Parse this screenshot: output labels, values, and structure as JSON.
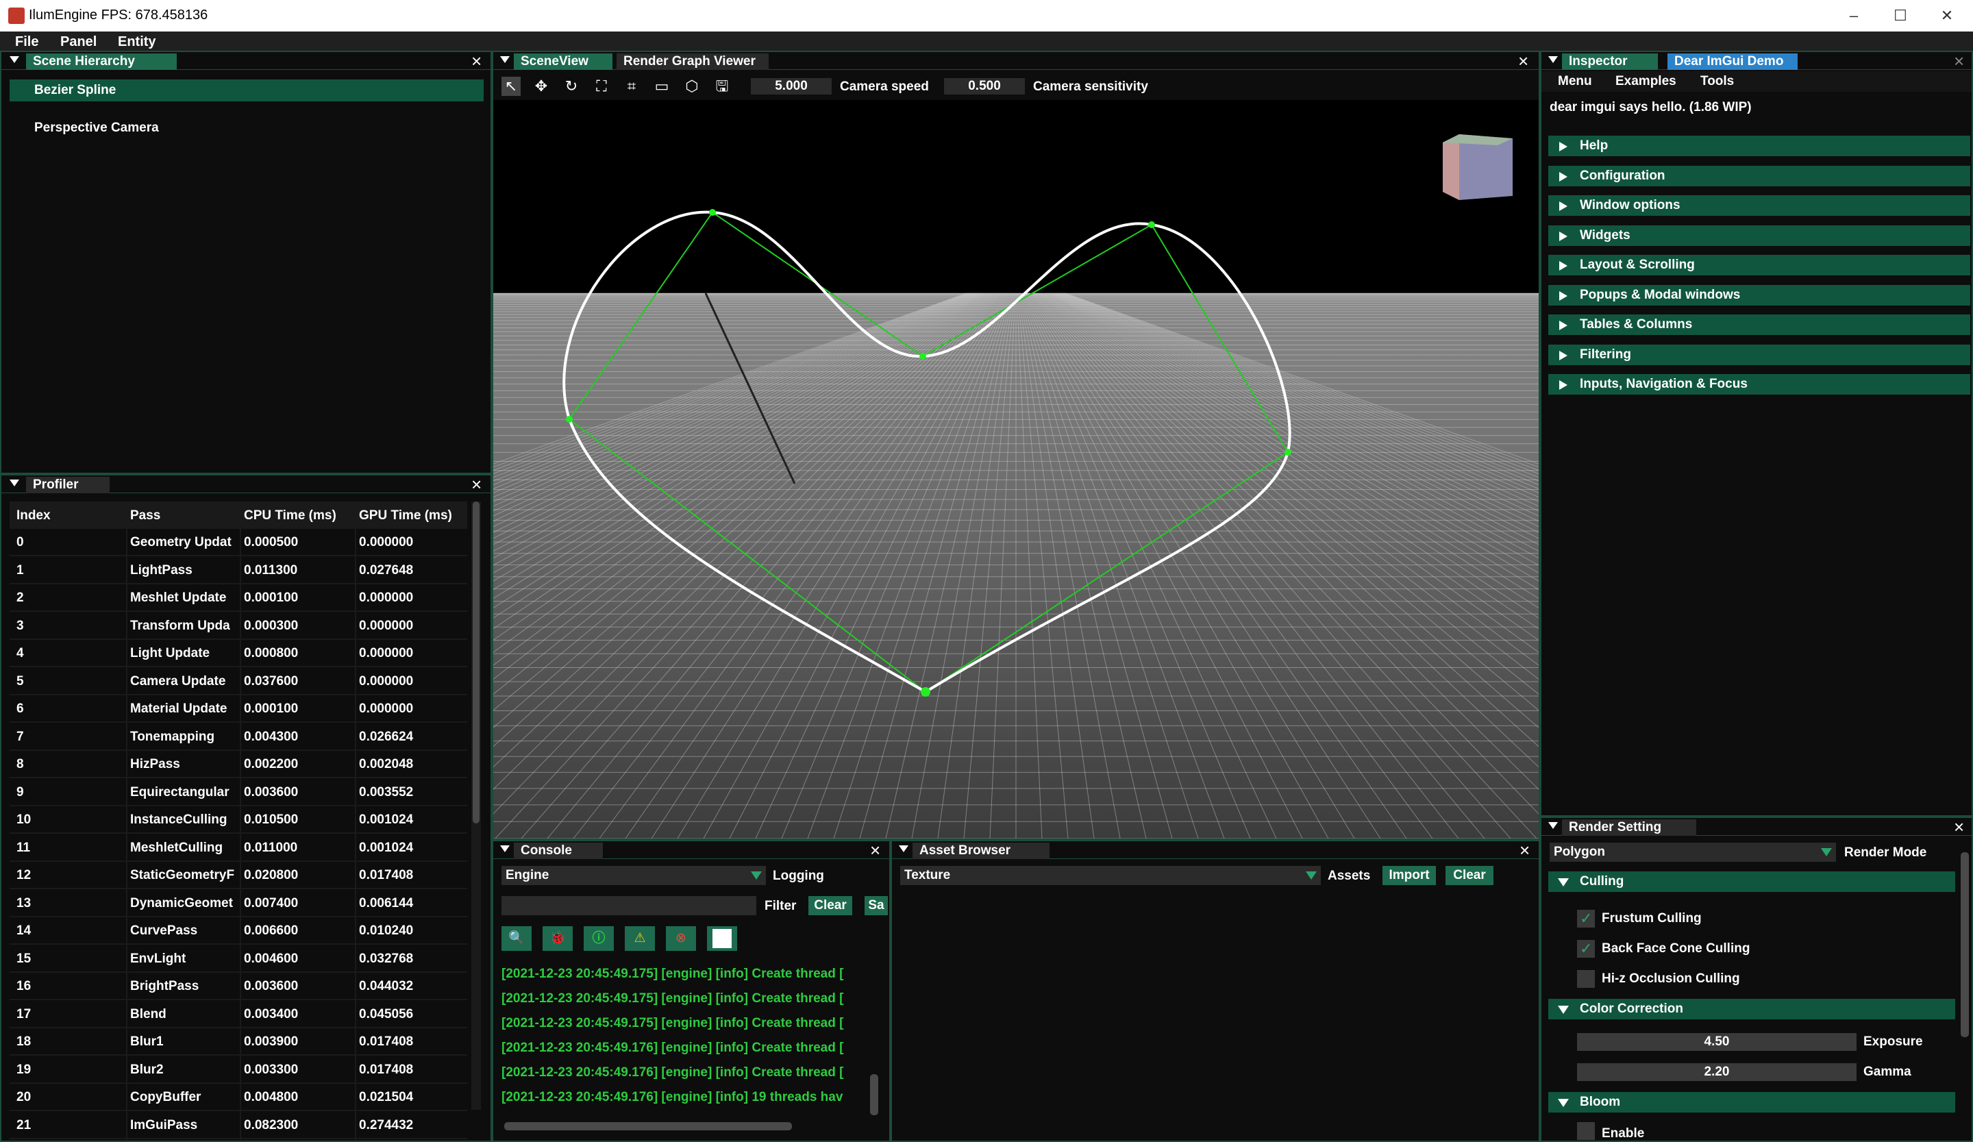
{
  "window": {
    "title": "IlumEngine FPS: 678.458136",
    "minimize": "–",
    "maximize": "☐",
    "close": "✕"
  },
  "menu": [
    "File",
    "Panel",
    "Entity"
  ],
  "scene_hierarchy": {
    "tab": "Scene Hierarchy",
    "items": [
      "Bezier Spline",
      "Perspective Camera"
    ]
  },
  "profiler": {
    "tab": "Profiler",
    "columns": [
      "Index",
      "Pass",
      "CPU Time (ms)",
      "GPU Time (ms)"
    ],
    "rows": [
      [
        "0",
        "Geometry Updat",
        "0.000500",
        "0.000000"
      ],
      [
        "1",
        "LightPass",
        "0.011300",
        "0.027648"
      ],
      [
        "2",
        "Meshlet Update",
        "0.000100",
        "0.000000"
      ],
      [
        "3",
        "Transform Upda",
        "0.000300",
        "0.000000"
      ],
      [
        "4",
        "Light Update",
        "0.000800",
        "0.000000"
      ],
      [
        "5",
        "Camera Update",
        "0.037600",
        "0.000000"
      ],
      [
        "6",
        "Material Update",
        "0.000100",
        "0.000000"
      ],
      [
        "7",
        "Tonemapping",
        "0.004300",
        "0.026624"
      ],
      [
        "8",
        "HizPass",
        "0.002200",
        "0.002048"
      ],
      [
        "9",
        "Equirectangular",
        "0.003600",
        "0.003552"
      ],
      [
        "10",
        "InstanceCulling",
        "0.010500",
        "0.001024"
      ],
      [
        "11",
        "MeshletCulling",
        "0.011000",
        "0.001024"
      ],
      [
        "12",
        "StaticGeometryF",
        "0.020800",
        "0.017408"
      ],
      [
        "13",
        "DynamicGeomet",
        "0.007400",
        "0.006144"
      ],
      [
        "14",
        "CurvePass",
        "0.006600",
        "0.010240"
      ],
      [
        "15",
        "EnvLight",
        "0.004600",
        "0.032768"
      ],
      [
        "16",
        "BrightPass",
        "0.003600",
        "0.044032"
      ],
      [
        "17",
        "Blend",
        "0.003400",
        "0.045056"
      ],
      [
        "18",
        "Blur1",
        "0.003900",
        "0.017408"
      ],
      [
        "19",
        "Blur2",
        "0.003300",
        "0.017408"
      ],
      [
        "20",
        "CopyBuffer",
        "0.004800",
        "0.021504"
      ],
      [
        "21",
        "ImGuiPass",
        "0.082300",
        "0.274432"
      ]
    ]
  },
  "scene_view": {
    "tabs": [
      "SceneView",
      "Render Graph Viewer"
    ],
    "camera_speed_value": "5.000",
    "camera_speed_label": "Camera speed",
    "camera_sensitivity_value": "0.500",
    "camera_sensitivity_label": "Camera sensitivity"
  },
  "console": {
    "tab": "Console",
    "combo_value": "Engine",
    "logging_label": "Logging",
    "filter_label": "Filter",
    "clear_label": "Clear",
    "save_label": "Sa",
    "lines": [
      "[2021-12-23 20:45:49.175] [engine] [info] Create thread [",
      "[2021-12-23 20:45:49.175] [engine] [info] Create thread [",
      "[2021-12-23 20:45:49.175] [engine] [info] Create thread [",
      "[2021-12-23 20:45:49.176] [engine] [info] Create thread [",
      "[2021-12-23 20:45:49.176] [engine] [info] Create thread [",
      "[2021-12-23 20:45:49.176] [engine] [info] 19 threads hav"
    ]
  },
  "asset_browser": {
    "tab": "Asset Browser",
    "combo_value": "Texture",
    "assets_label": "Assets",
    "import_label": "Import",
    "clear_label": "Clear"
  },
  "inspector": {
    "tabs": [
      "Inspector",
      "Dear ImGui Demo"
    ],
    "menu": [
      "Menu",
      "Examples",
      "Tools"
    ],
    "hello": "dear imgui says hello. (1.86 WIP)",
    "sections": [
      "Help",
      "Configuration",
      "Window options",
      "Widgets",
      "Layout & Scrolling",
      "Popups & Modal windows",
      "Tables & Columns",
      "Filtering",
      "Inputs, Navigation & Focus"
    ]
  },
  "render_setting": {
    "tab": "Render Setting",
    "render_mode_value": "Polygon",
    "render_mode_label": "Render Mode",
    "culling_header": "Culling",
    "culling": [
      {
        "label": "Frustum Culling",
        "checked": true
      },
      {
        "label": "Back Face Cone Culling",
        "checked": true
      },
      {
        "label": "Hi-z Occlusion Culling",
        "checked": false
      }
    ],
    "color_header": "Color Correction",
    "exposure_value": "4.50",
    "exposure_label": "Exposure",
    "gamma_value": "2.20",
    "gamma_label": "Gamma",
    "bloom_header": "Bloom",
    "bloom_enable_label": "Enable"
  },
  "colors": {
    "accent": "#1e6b50",
    "log_text": "#2ecc40",
    "spline": "#ffffff",
    "control_polygon": "#22cc22"
  }
}
